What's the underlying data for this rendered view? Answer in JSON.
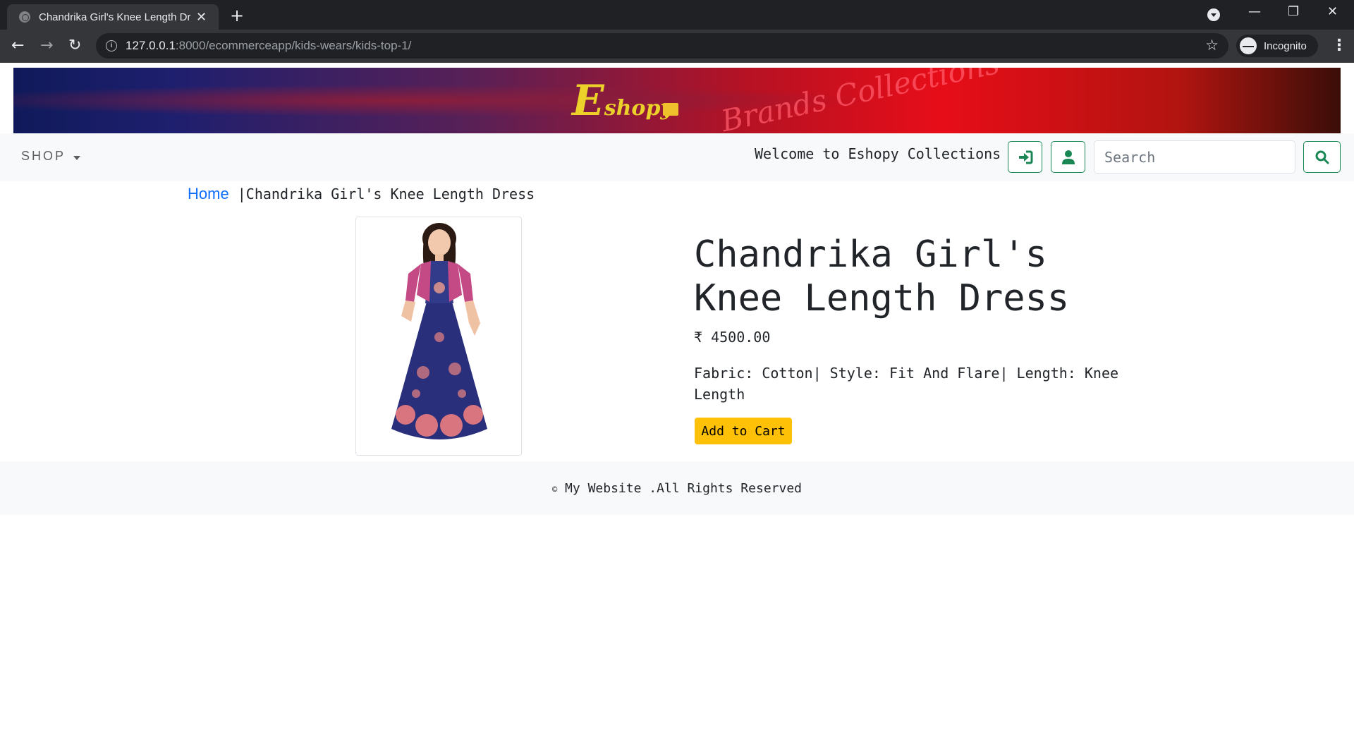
{
  "browser": {
    "tab_title": "Chandrika Girl's Knee Length Dre",
    "new_tab_label": "+",
    "url_host": "127.0.0.1",
    "url_path": ":8000/ecommerceapp/kids-wears/kids-top-1/",
    "profile_label": "Incognito"
  },
  "banner": {
    "logo_letter": "E",
    "logo_rest": "shopy",
    "script_text": "Brands Collections"
  },
  "nav": {
    "shop_label": "SHOP",
    "welcome_text": "Welcome to Eshopy Collections",
    "search_placeholder": "Search"
  },
  "breadcrumb": {
    "home": "Home",
    "separator": "|",
    "current": "Chandrika Girl's Knee Length Dress"
  },
  "product": {
    "title": "Chandrika Girl's Knee Length Dress",
    "price": "₹ 4500.00",
    "description": "Fabric: Cotton| Style: Fit And Flare| Length: Knee Length",
    "add_to_cart": "Add to Cart"
  },
  "footer": {
    "copyright_symbol": "©",
    "text": " My Website .All Rights Reserved"
  },
  "colors": {
    "accent_green": "#198754",
    "cart_yellow": "#ffc107",
    "link_blue": "#0d6efd"
  }
}
